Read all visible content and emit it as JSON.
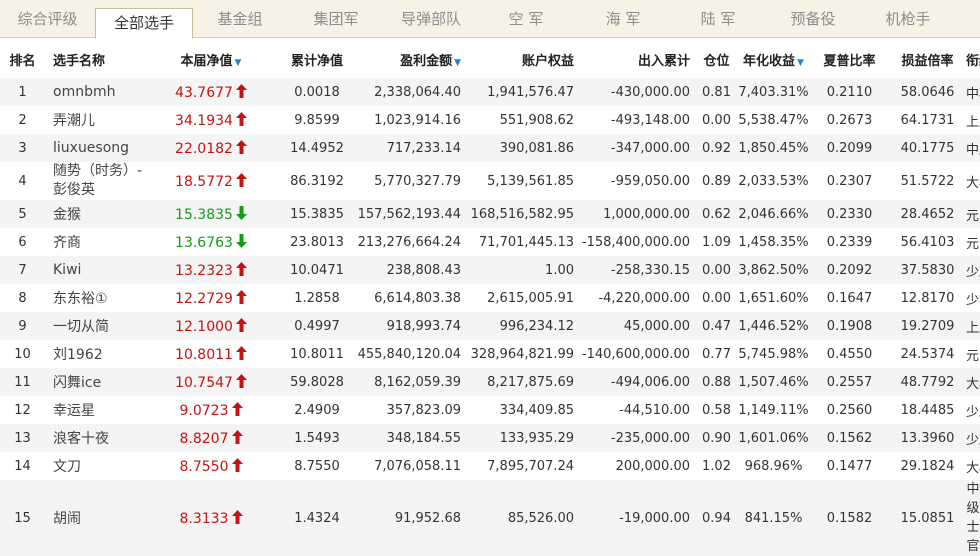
{
  "tabs": [
    {
      "label": "综合评级",
      "active": false
    },
    {
      "label": "全部选手",
      "active": true
    },
    {
      "label": "基金组",
      "active": false
    },
    {
      "label": "集团军",
      "active": false
    },
    {
      "label": "导弹部队",
      "active": false
    },
    {
      "label": "空  军",
      "active": false
    },
    {
      "label": "海  军",
      "active": false
    },
    {
      "label": "陆  军",
      "active": false
    },
    {
      "label": "预备役",
      "active": false
    },
    {
      "label": "机枪手",
      "active": false
    }
  ],
  "columns": [
    "排名",
    "选手名称",
    "本届净值",
    "累计净值",
    "盈利金额",
    "账户权益",
    "出入累计",
    "仓位",
    "年化收益",
    "夏普比率",
    "损益倍率",
    "衔级"
  ],
  "colors": {
    "up": "#c51313",
    "down": "#169a16",
    "sort": "#1f88c9"
  },
  "rows": [
    {
      "rank": "1",
      "name": "omnbmh",
      "net": "43.7677",
      "trend": "up",
      "cum": "0.0018",
      "profit": "2,338,064.40",
      "equity": "1,941,576.47",
      "flow": "-430,000.00",
      "pos": "0.81",
      "annual": "7,403.31%",
      "sharpe": "0.2110",
      "pl": "58.0646",
      "title": "中校"
    },
    {
      "rank": "2",
      "name": "弄潮儿",
      "net": "34.1934",
      "trend": "up",
      "cum": "9.8599",
      "profit": "1,023,914.16",
      "equity": "551,908.62",
      "flow": "-493,148.00",
      "pos": "0.00",
      "annual": "5,538.47%",
      "sharpe": "0.2673",
      "pl": "64.1731",
      "title": "上尉"
    },
    {
      "rank": "3",
      "name": "liuxuesong",
      "net": "22.0182",
      "trend": "up",
      "cum": "14.4952",
      "profit": "717,233.14",
      "equity": "390,081.86",
      "flow": "-347,000.00",
      "pos": "0.92",
      "annual": "1,850.45%",
      "sharpe": "0.2099",
      "pl": "40.1775",
      "title": "中尉"
    },
    {
      "rank": "4",
      "name": "随势（时务）-彭俊英",
      "net": "18.5772",
      "trend": "up",
      "cum": "86.3192",
      "profit": "5,770,327.79",
      "equity": "5,139,561.85",
      "flow": "-959,050.00",
      "pos": "0.89",
      "annual": "2,033.53%",
      "sharpe": "0.2307",
      "pl": "51.5722",
      "title": "大校"
    },
    {
      "rank": "5",
      "name": "金猴",
      "net": "15.3835",
      "trend": "down",
      "cum": "15.3835",
      "profit": "157,562,193.44",
      "equity": "168,516,582.95",
      "flow": "1,000,000.00",
      "pos": "0.62",
      "annual": "2,046.66%",
      "sharpe": "0.2330",
      "pl": "28.4652",
      "title": "元帅"
    },
    {
      "rank": "6",
      "name": "齐商",
      "net": "13.6763",
      "trend": "down",
      "cum": "23.8013",
      "profit": "213,276,664.24",
      "equity": "71,701,445.13",
      "flow": "-158,400,000.00",
      "pos": "1.09",
      "annual": "1,458.35%",
      "sharpe": "0.2339",
      "pl": "56.4103",
      "title": "元帅"
    },
    {
      "rank": "7",
      "name": "Kiwi",
      "net": "13.2323",
      "trend": "up",
      "cum": "10.0471",
      "profit": "238,808.43",
      "equity": "1.00",
      "flow": "-258,330.15",
      "pos": "0.00",
      "annual": "3,862.50%",
      "sharpe": "0.2092",
      "pl": "37.5830",
      "title": "少尉"
    },
    {
      "rank": "8",
      "name": "东东裕①",
      "net": "12.2729",
      "trend": "up",
      "cum": "1.2858",
      "profit": "6,614,803.38",
      "equity": "2,615,005.91",
      "flow": "-4,220,000.00",
      "pos": "0.00",
      "annual": "1,651.60%",
      "sharpe": "0.1647",
      "pl": "12.8170",
      "title": "少将"
    },
    {
      "rank": "9",
      "name": "一切从简",
      "net": "12.1000",
      "trend": "up",
      "cum": "0.4997",
      "profit": "918,993.74",
      "equity": "996,234.12",
      "flow": "45,000.00",
      "pos": "0.47",
      "annual": "1,446.52%",
      "sharpe": "0.1908",
      "pl": "19.2709",
      "title": "上尉"
    },
    {
      "rank": "10",
      "name": "刘1962",
      "net": "10.8011",
      "trend": "up",
      "cum": "10.8011",
      "profit": "455,840,120.04",
      "equity": "328,964,821.99",
      "flow": "-140,600,000.00",
      "pos": "0.77",
      "annual": "5,745.98%",
      "sharpe": "0.4550",
      "pl": "24.5374",
      "title": "元帅"
    },
    {
      "rank": "11",
      "name": "闪舞ice",
      "net": "10.7547",
      "trend": "up",
      "cum": "59.8028",
      "profit": "8,162,059.39",
      "equity": "8,217,875.69",
      "flow": "-494,006.00",
      "pos": "0.88",
      "annual": "1,507.46%",
      "sharpe": "0.2557",
      "pl": "48.7792",
      "title": "大校"
    },
    {
      "rank": "12",
      "name": "幸运星",
      "net": "9.0723",
      "trend": "up",
      "cum": "2.4909",
      "profit": "357,823.09",
      "equity": "334,409.85",
      "flow": "-44,510.00",
      "pos": "0.58",
      "annual": "1,149.11%",
      "sharpe": "0.2560",
      "pl": "18.4485",
      "title": "少尉"
    },
    {
      "rank": "13",
      "name": "浪客十夜",
      "net": "8.8207",
      "trend": "up",
      "cum": "1.5493",
      "profit": "348,184.55",
      "equity": "133,935.29",
      "flow": "-235,000.00",
      "pos": "0.90",
      "annual": "1,601.06%",
      "sharpe": "0.1562",
      "pl": "13.3960",
      "title": "少尉"
    },
    {
      "rank": "14",
      "name": "文刀",
      "net": "8.7550",
      "trend": "up",
      "cum": "8.7550",
      "profit": "7,076,058.11",
      "equity": "7,895,707.24",
      "flow": "200,000.00",
      "pos": "1.02",
      "annual": "968.96%",
      "sharpe": "0.1477",
      "pl": "29.1824",
      "title": "大校"
    },
    {
      "rank": "15",
      "name": "胡闹",
      "net": "8.3133",
      "trend": "up",
      "cum": "1.4324",
      "profit": "91,952.68",
      "equity": "85,526.00",
      "flow": "-19,000.00",
      "pos": "0.94",
      "annual": "841.15%",
      "sharpe": "0.1582",
      "pl": "15.0851",
      "title": "中级士官"
    }
  ]
}
